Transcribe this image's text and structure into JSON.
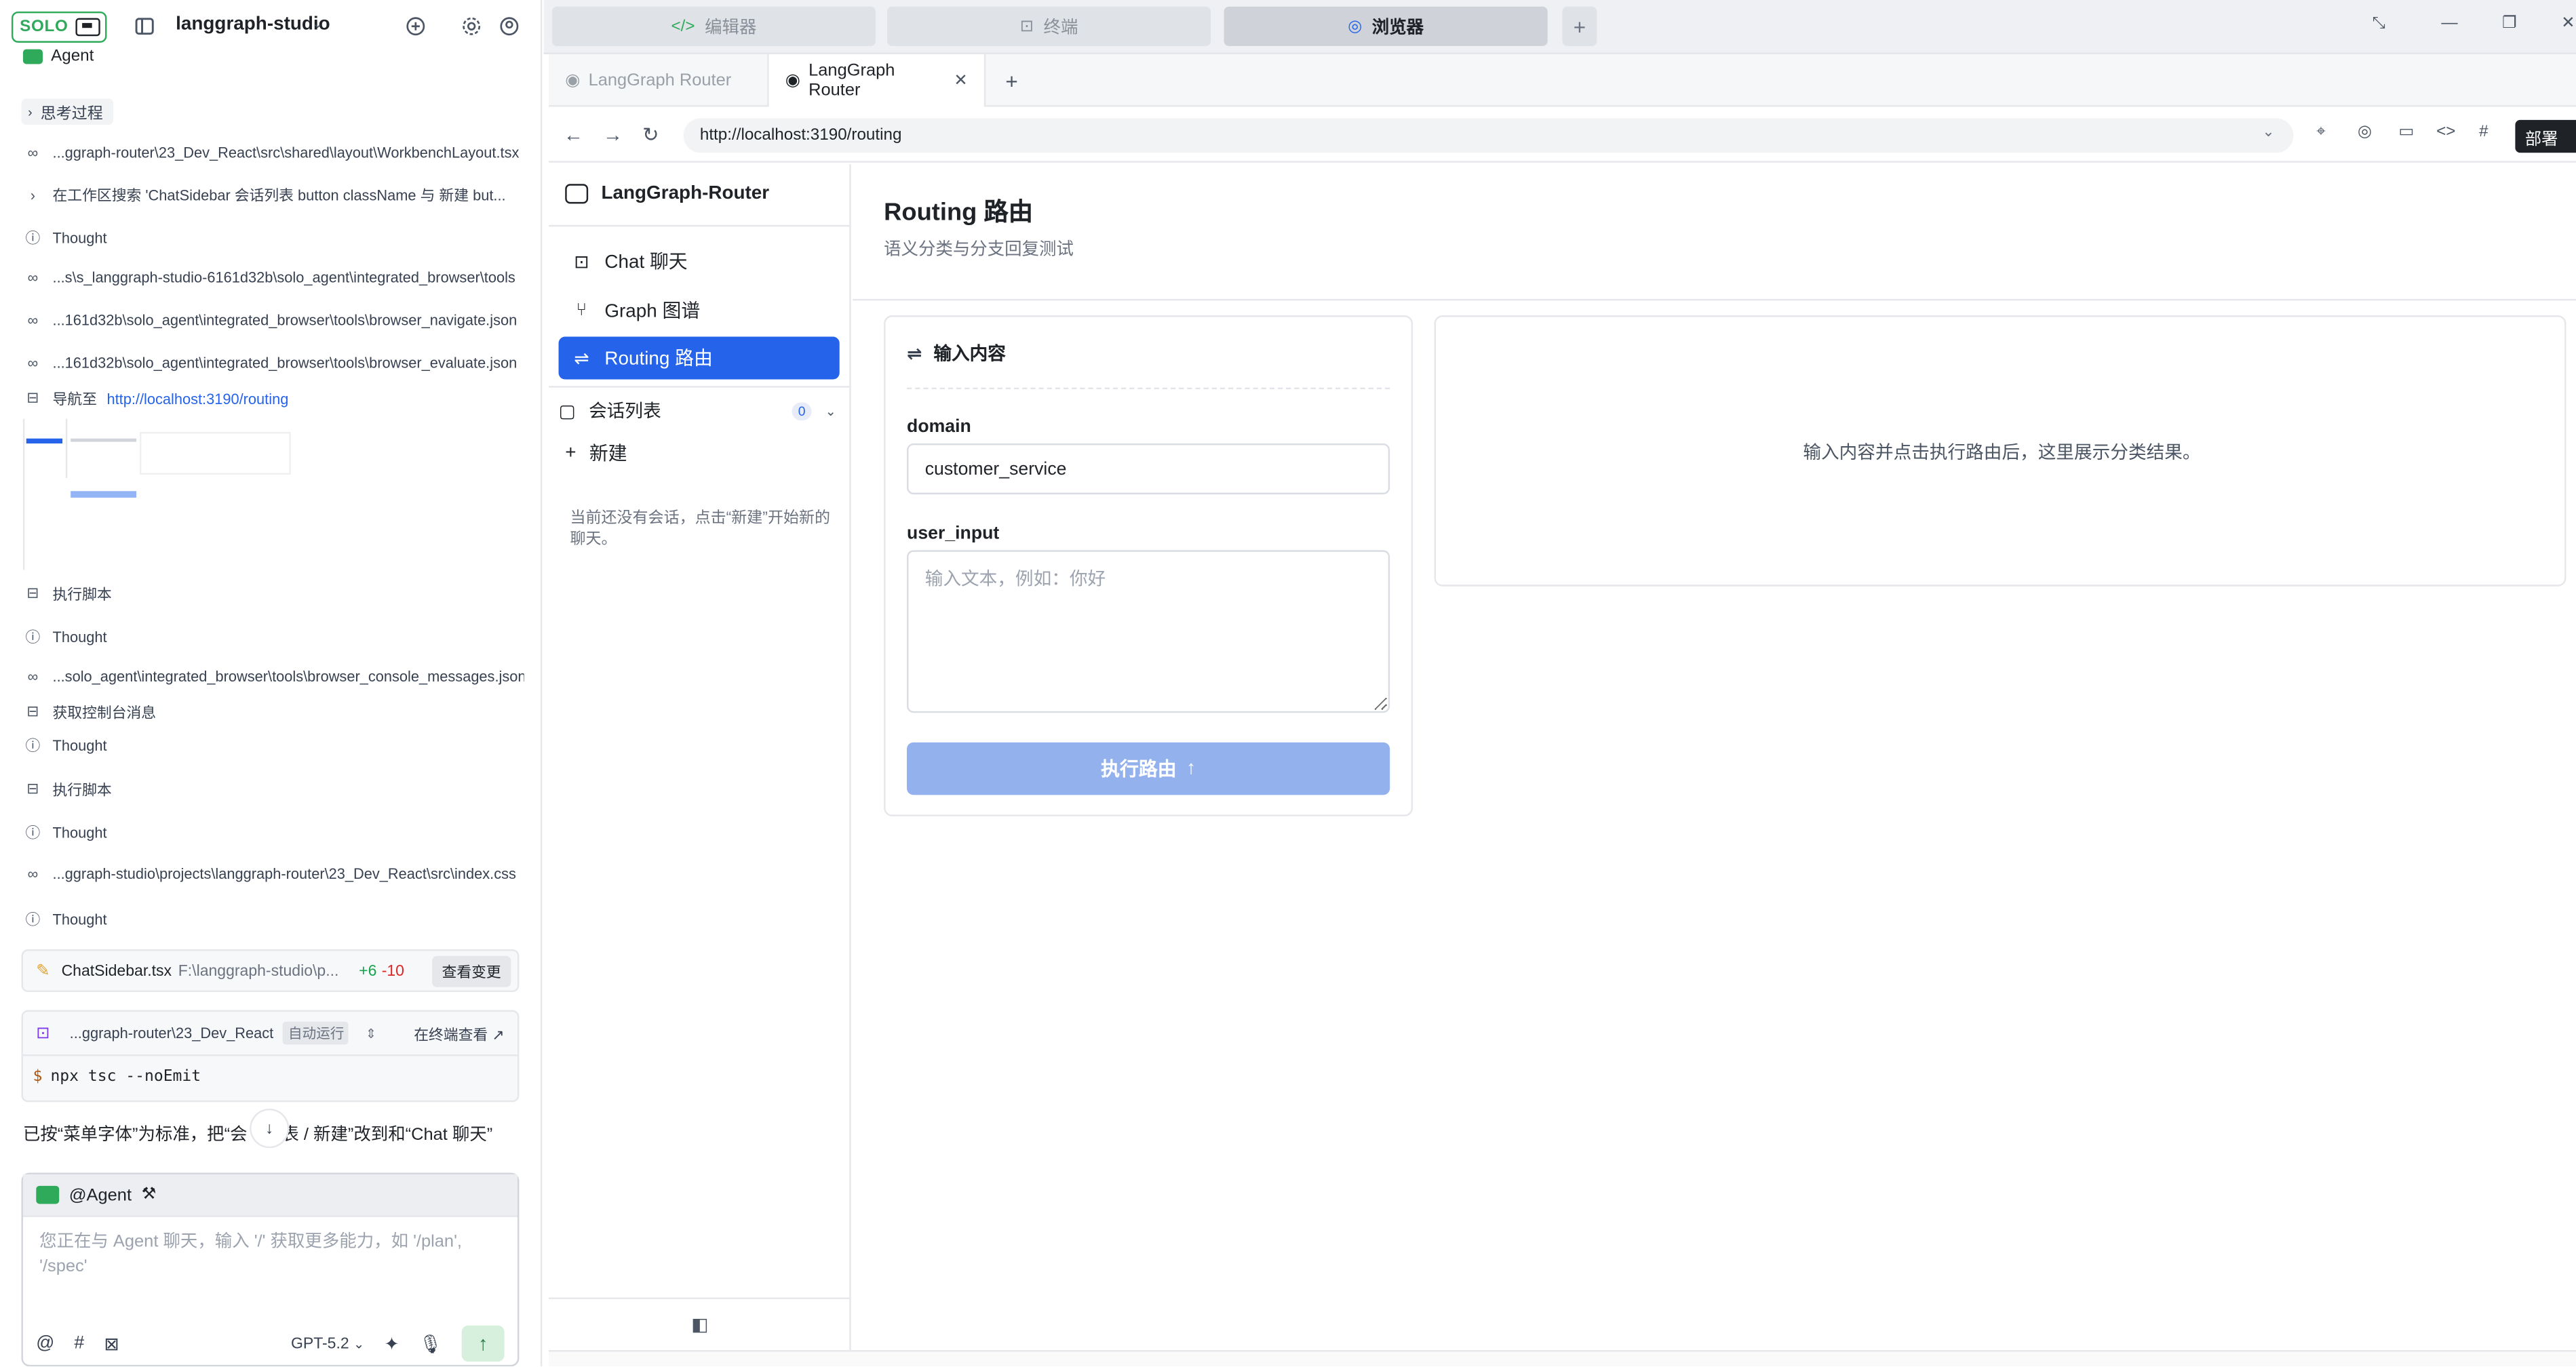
{
  "left_panel": {
    "header": {
      "solo_label": "SOLO",
      "project_name": "langgraph-studio"
    },
    "agent_label": "Agent",
    "thinking_toggle": "思考过程",
    "activity": [
      {
        "icon": "glasses-icon",
        "text": "...ggraph-router\\23_Dev_React\\src\\shared\\layout\\WorkbenchLayout.tsx"
      },
      {
        "icon": "chevron-right-icon",
        "text": "在工作区搜索 'ChatSidebar 会话列表 button className 与 新建 but..."
      },
      {
        "icon": "info-icon",
        "text": "Thought"
      },
      {
        "icon": "glasses-icon",
        "text": "...s\\s_langgraph-studio-6161d32b\\solo_agent\\integrated_browser\\tools"
      },
      {
        "icon": "glasses-icon",
        "text": "...161d32b\\solo_agent\\integrated_browser\\tools\\browser_navigate.json"
      },
      {
        "icon": "glasses-icon",
        "text": "...161d32b\\solo_agent\\integrated_browser\\tools\\browser_evaluate.json"
      },
      {
        "icon": "browser-icon",
        "text": "导航至",
        "link": "http://localhost:3190/routing"
      },
      {
        "icon": "browser-icon",
        "text": "执行脚本"
      },
      {
        "icon": "info-icon",
        "text": "Thought"
      },
      {
        "icon": "glasses-icon",
        "text": "...solo_agent\\integrated_browser\\tools\\browser_console_messages.json"
      },
      {
        "icon": "browser-icon",
        "text": "获取控制台消息"
      },
      {
        "icon": "info-icon",
        "text": "Thought"
      },
      {
        "icon": "browser-icon",
        "text": "执行脚本"
      },
      {
        "icon": "info-icon",
        "text": "Thought"
      },
      {
        "icon": "glasses-icon",
        "text": "...ggraph-studio\\projects\\langgraph-router\\23_Dev_React\\src\\index.css"
      },
      {
        "icon": "info-icon",
        "text": "Thought"
      }
    ],
    "file_card": {
      "file_name": "ChatSidebar.tsx",
      "file_path": "F:\\langgraph-studio\\p...",
      "additions": "+6",
      "deletions": "-10",
      "view_button": "查看变更"
    },
    "terminal_card": {
      "path": "...ggraph-router\\23_Dev_React",
      "mode": "自动运行",
      "open_in_terminal": "在终端查看",
      "prompt": "$",
      "command": "npx tsc --noEmit"
    },
    "summary": "已按“菜单字体”为标准，把“会　　表 / 新建”改到和“Chat 聊天”",
    "composer": {
      "mention": "@Agent",
      "placeholder": "您正在与 Agent 聊天，输入 '/' 获取更多能力，如 '/plan', '/spec'",
      "model": "GPT-5.2"
    }
  },
  "top_tabs": {
    "editor": "编辑器",
    "terminal": "终端",
    "browser": "浏览器",
    "add": "+"
  },
  "browser": {
    "tabs": [
      {
        "label": "LangGraph Router"
      },
      {
        "label": "LangGraph Router"
      }
    ],
    "url": "http://localhost:3190/routing",
    "deploy_label": "部署"
  },
  "app": {
    "brand": "LangGraph-Router",
    "nav": [
      {
        "label": "Chat 聊天",
        "icon": "bot-icon"
      },
      {
        "label": "Graph 图谱",
        "icon": "git-branch-icon"
      },
      {
        "label": "Routing 路由",
        "icon": "route-icon"
      }
    ],
    "conversations": {
      "title": "会话列表",
      "count": "0",
      "new_label": "新建",
      "empty_text": "当前还没有会话，点击“新建”开始新的聊天。"
    },
    "page": {
      "title": "Routing 路由",
      "subtitle": "语义分类与分支回复测试"
    },
    "input_card": {
      "title": "输入内容",
      "domain_label": "domain",
      "domain_value": "customer_service",
      "user_input_label": "user_input",
      "user_input_placeholder": "输入文本，例如：你好",
      "run_button": "执行路由"
    },
    "result_placeholder": "输入内容并点击执行路由后，这里展示分类结果。"
  }
}
